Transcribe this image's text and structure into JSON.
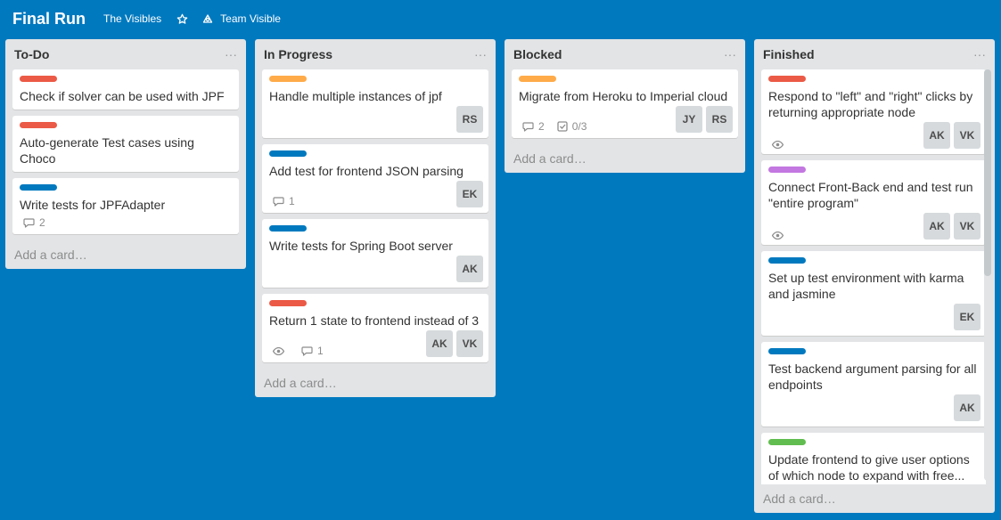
{
  "board": {
    "title": "Final Run",
    "org": "The Visibles",
    "star_icon": "star-icon",
    "team": "Team Visible",
    "team_icon": "team-icon"
  },
  "colors": {
    "background": "#0079bf",
    "red": "#eb5a46",
    "orange": "#ffab4a",
    "blue": "#0079bf",
    "purple": "#c377e0",
    "green": "#61bd4f"
  },
  "add_card": "Add a card…",
  "lists": [
    {
      "title": "To-Do",
      "cards": [
        {
          "label": "red",
          "title": "Check if solver can be used with JPF"
        },
        {
          "label": "red",
          "title": "Auto-generate Test cases using Choco"
        },
        {
          "label": "blue",
          "title": "Write tests for JPFAdapter",
          "comments": "2"
        }
      ]
    },
    {
      "title": "In Progress",
      "cards": [
        {
          "label": "orange",
          "title": "Handle multiple instances of jpf",
          "members": [
            "RS"
          ]
        },
        {
          "label": "blue",
          "title": "Add test for frontend JSON parsing",
          "comments": "1",
          "members": [
            "EK"
          ]
        },
        {
          "label": "blue",
          "title": "Write tests for Spring Boot server",
          "members": [
            "AK"
          ]
        },
        {
          "label": "red",
          "title": "Return 1 state to frontend instead of 3",
          "watch": true,
          "comments": "1",
          "members": [
            "AK",
            "VK"
          ]
        }
      ]
    },
    {
      "title": "Blocked",
      "cards": [
        {
          "label": "orange",
          "title": "Migrate from Heroku to Imperial cloud",
          "comments": "2",
          "checklist": "0/3",
          "members": [
            "JY",
            "RS"
          ]
        }
      ]
    },
    {
      "title": "Finished",
      "cards": [
        {
          "label": "red",
          "title": "Respond to \"left\" and \"right\" clicks by returning appropriate node",
          "watch": true,
          "members": [
            "AK",
            "VK"
          ]
        },
        {
          "label": "purple",
          "title": "Connect Front-Back end and test run \"entire program\"",
          "watch": true,
          "members": [
            "AK",
            "VK"
          ]
        },
        {
          "label": "blue",
          "title": "Set up test environment with karma and jasmine",
          "members": [
            "EK"
          ]
        },
        {
          "label": "blue",
          "title": "Test backend argument parsing for all endpoints",
          "members": [
            "AK"
          ]
        },
        {
          "label": "green",
          "title": "Update frontend to give user options of which node to expand with free..."
        }
      ]
    }
  ]
}
